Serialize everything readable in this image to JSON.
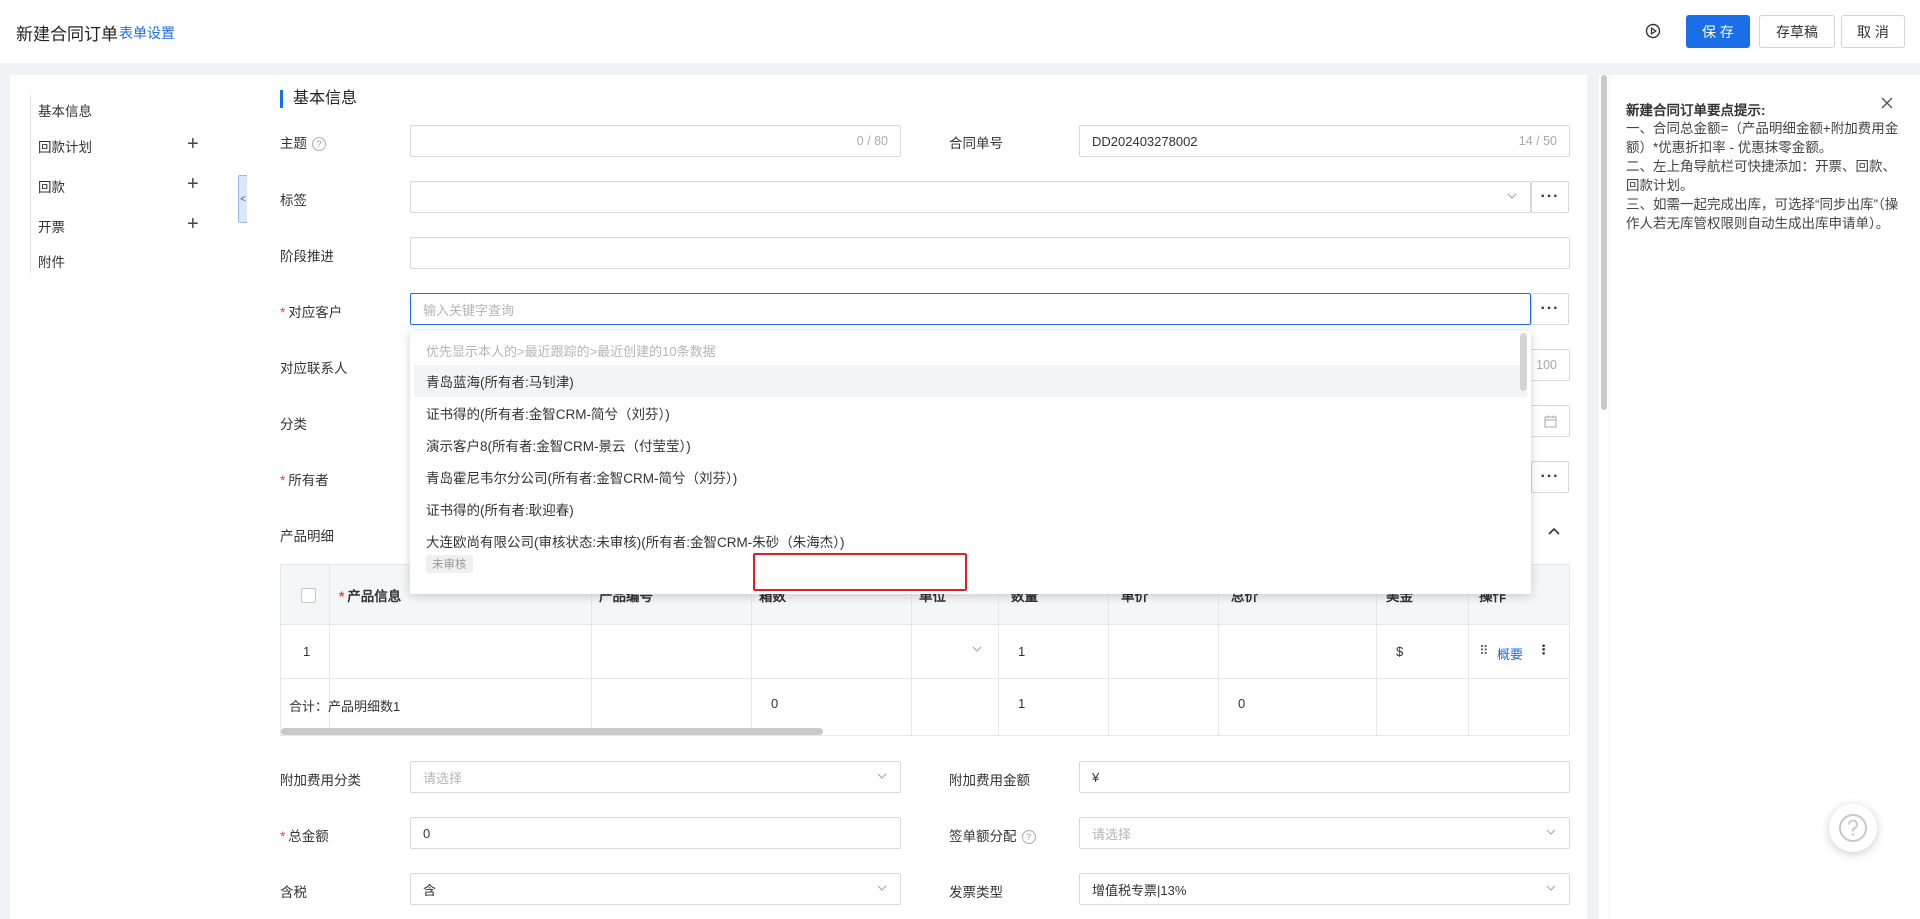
{
  "header": {
    "title": "新建合同订单",
    "form_settings": "表单设置",
    "save": "保 存",
    "draft": "存草稿",
    "cancel": "取 消"
  },
  "nav": {
    "items": [
      {
        "label": "基本信息",
        "plus": false
      },
      {
        "label": "回款计划",
        "plus": true
      },
      {
        "label": "回款",
        "plus": true
      },
      {
        "label": "开票",
        "plus": true
      },
      {
        "label": "附件",
        "plus": false
      }
    ]
  },
  "section": {
    "title": "基本信息"
  },
  "form": {
    "subject_label": "主题",
    "subject_counter": "0 / 80",
    "contract_no_label": "合同单号",
    "contract_no_value": "DD202403278002",
    "contract_no_counter": "14 / 50",
    "tags_label": "标签",
    "stage_label": "阶段推进",
    "customer_label": "对应客户",
    "customer_placeholder": "输入关键字查询",
    "contact_label": "对应联系人",
    "contact_counter_partial": "100",
    "category_label": "分类",
    "owner_label": "所有者",
    "product_label": "产品明细",
    "extra_fee_cat_label": "附加费用分类",
    "extra_fee_cat_placeholder": "请选择",
    "extra_fee_amount_label": "附加费用金额",
    "extra_fee_amount_value": "¥",
    "total_label": "总金额",
    "total_value": "0",
    "sign_alloc_label": "签单额分配",
    "sign_alloc_placeholder": "请选择",
    "tax_label": "含税",
    "tax_value": "含",
    "invoice_type_label": "发票类型",
    "invoice_type_value": "增值税专票|13%",
    "required_mark": "*",
    "more": "···"
  },
  "table": {
    "headers": {
      "product_info": "产品信息",
      "product_code": "产品编号",
      "box_count": "箱数",
      "unit": "单位",
      "quantity": "数量",
      "unit_price": "单价",
      "total": "总价",
      "usd": "美金",
      "actions": "操作"
    },
    "row": {
      "index": "1",
      "quantity": "1",
      "usd": "$",
      "summary_link": "概要"
    },
    "summary": {
      "label": "合计：产品明细数1",
      "box_total": "0",
      "quantity_total": "1",
      "total_total": "0"
    }
  },
  "dropdown": {
    "hint": "优先显示本人的>最近跟踪的>最近创建的10条数据",
    "items": [
      "青岛蓝海(所有者:马钊津)",
      "证书得的(所有者:金智CRM-简兮（刘芬）)",
      "演示客户8(所有者:金智CRM-景云（付莹莹）)",
      "青岛霍尼韦尔分公司(所有者:金智CRM-简兮（刘芬）)",
      "证书得的(所有者:耿迎春)",
      "大连欧尚有限公司(审核状态:未审核)(所有者:金智CRM-朱砂（朱海杰）)"
    ],
    "tag": "未审核"
  },
  "tips": {
    "title": "新建合同订单要点提示:",
    "lines": [
      "一、合同总金额=（产品明细金额+附加费用金额）*优惠折扣率 - 优惠抹零金额。",
      "二、左上角导航栏可快捷添加：开票、回款、回款计划。",
      "三、如需一起完成出库，可选择“同步出库”（操作人若无库管权限则自动生成出库申请单）。"
    ]
  },
  "colors": {
    "primary": "#1a6fe8",
    "required": "#e54b4b",
    "highlight_box": "#e02020"
  }
}
